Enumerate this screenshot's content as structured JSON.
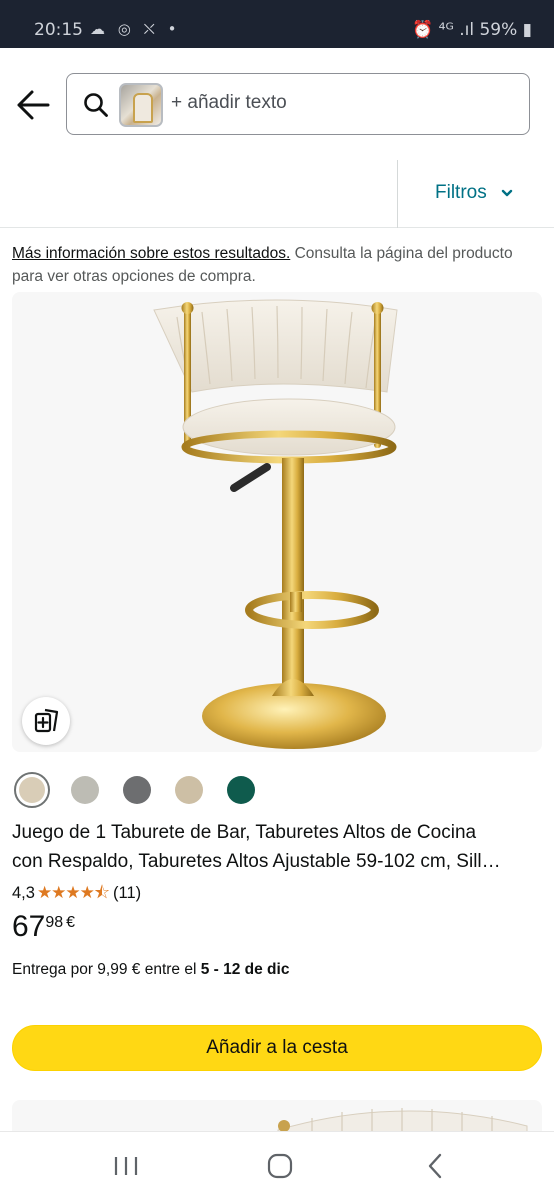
{
  "status_bar": {
    "time": "20:15",
    "left_icons": "☁ ◎ ⛌ •",
    "right_text": "⏰ ⁴ᴳ .ıl 59% ▮"
  },
  "search": {
    "placeholder": "+ añadir texto",
    "thumbnail": "product-thumbnail"
  },
  "filters": {
    "label": "Filtros",
    "chevron": "⌄"
  },
  "info": {
    "link_text": "Más información sobre estos resultados.",
    "rest_text": " Consulta la página del producto para ver otras opciones de compra."
  },
  "product": {
    "swatches": [
      {
        "color": "#d9cdb7",
        "selected": true
      },
      {
        "color": "#bdbcb4",
        "selected": false
      },
      {
        "color": "#6d6e70",
        "selected": false
      },
      {
        "color": "#cdbfa5",
        "selected": false
      },
      {
        "color": "#0f5b4d",
        "selected": false
      }
    ],
    "title_line1": "Juego de 1 Taburete de Bar, Taburetes Altos de Cocina",
    "title_line2": "con Respaldo, Taburetes Altos Ajustable 59-102 cm, Sill…",
    "rating_value": "4,3",
    "stars": "★★★★⯪",
    "rating_fraction": 0.86,
    "review_count": "(11)",
    "price_whole": "67",
    "price_fraction": "98",
    "currency": "€",
    "delivery_prefix": "Entrega por 9,99 € entre el ",
    "delivery_dates": "5 - 12 de dic",
    "add_to_cart": "Añadir a la cesta"
  },
  "colors": {
    "accent_link": "#007185",
    "cart_button": "#ffd814",
    "star": "#de7921",
    "status_bar_bg": "#1c2331"
  },
  "nav": {
    "recents": "|||",
    "home": "◯",
    "back": "‹"
  }
}
